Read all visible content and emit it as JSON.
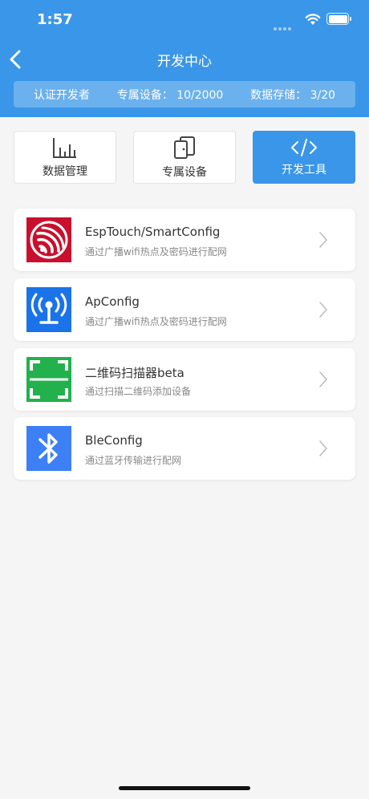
{
  "status_bar": {
    "time": "1:57"
  },
  "nav": {
    "title": "开发中心"
  },
  "info_bar": {
    "certified": "认证开发者",
    "devices_label": "专属设备：",
    "devices_value": "10/2000",
    "storage_label": "数据存储：",
    "storage_value": "3/20"
  },
  "tabs": [
    {
      "label": "数据管理",
      "icon": "bar-chart-icon",
      "active": false
    },
    {
      "label": "专属设备",
      "icon": "devices-icon",
      "active": false
    },
    {
      "label": "开发工具",
      "icon": "code-icon",
      "active": true
    }
  ],
  "tools": [
    {
      "title": "EspTouch/SmartConfig",
      "subtitle": "通过广播wifi热点及密码进行配网",
      "icon": "espressif-logo-icon",
      "color": "#c8102e"
    },
    {
      "title": "ApConfig",
      "subtitle": "通过广播wifi热点及密码进行配网",
      "icon": "antenna-icon",
      "color": "#1a73e8"
    },
    {
      "title": "二维码扫描器beta",
      "subtitle": "通过扫描二维码添加设备",
      "icon": "qr-scan-icon",
      "color": "#22b14c"
    },
    {
      "title": "BleConfig",
      "subtitle": "通过蓝牙传输进行配网",
      "icon": "bluetooth-icon",
      "color": "#3d7ff5"
    }
  ],
  "colors": {
    "primary": "#3a96e8",
    "background": "#f5f5f5"
  }
}
